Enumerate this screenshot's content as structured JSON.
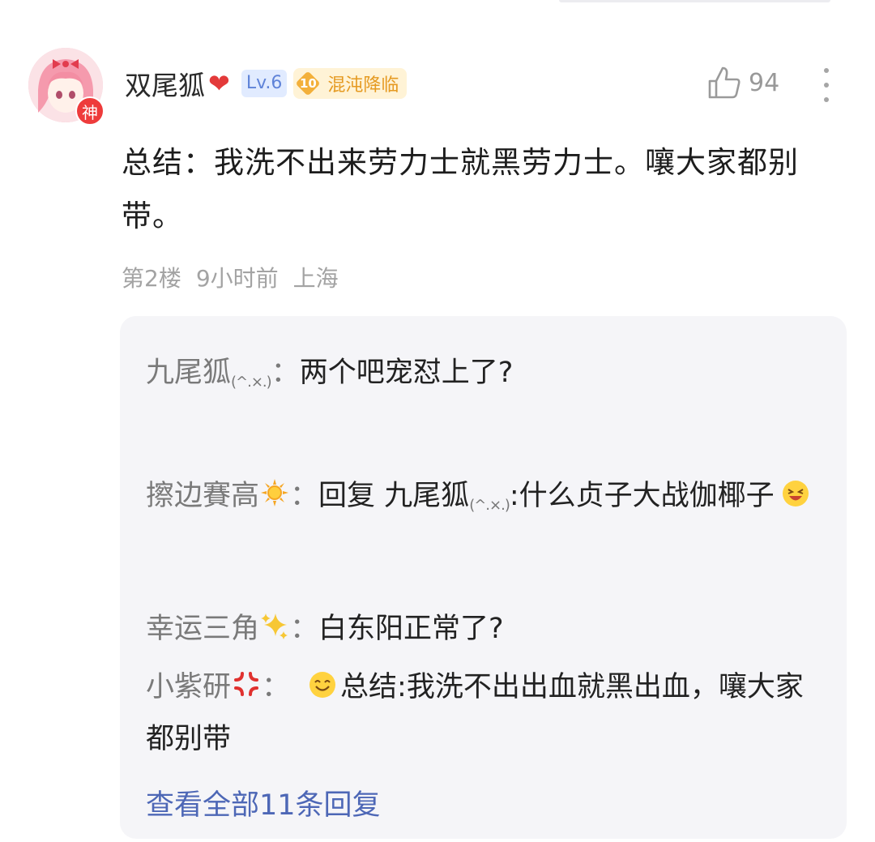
{
  "comment": {
    "username": "双尾狐",
    "level": "Lv.6",
    "title_badge": {
      "level": "10",
      "text": "混沌降临"
    },
    "avatar_badge": "神",
    "likes": "94",
    "text": "总结：我洗不出来劳力士就黑劳力士。嚷大家都别带。",
    "meta": {
      "floor": "第2楼",
      "time": "9小时前",
      "location": "上海"
    }
  },
  "replies": [
    {
      "name": "九尾狐",
      "kaomoji": "(^.×.)",
      "colon": "：",
      "content": "两个吧宠怼上了?"
    },
    {
      "name": "擦边賽高",
      "colon": "：",
      "prefix": "回复 ",
      "target": "九尾狐",
      "target_kaomoji": "(^.×.)",
      "content": ":什么贞子大战伽椰子"
    },
    {
      "name": "幸运三角",
      "colon": "：",
      "content": "白东阳正常了?"
    },
    {
      "name": "小紫研",
      "colon": "：",
      "content": "总结:我洗不出出血就黑出血，嚷大家都别带"
    }
  ],
  "view_all": "查看全部11条回复",
  "colors": {
    "link_blue": "#4d67b6",
    "badge_orange": "#e59a21",
    "level_blue": "#5f83d8",
    "heart_red": "#e33a3a",
    "reply_bg": "#f5f5f8"
  },
  "icons": [
    "heart-icon",
    "thumb-up-icon",
    "more-vertical-icon",
    "sun-emoji",
    "sparkles-emoji",
    "anger-emoji",
    "laughing-emoji",
    "smile-emoji"
  ]
}
